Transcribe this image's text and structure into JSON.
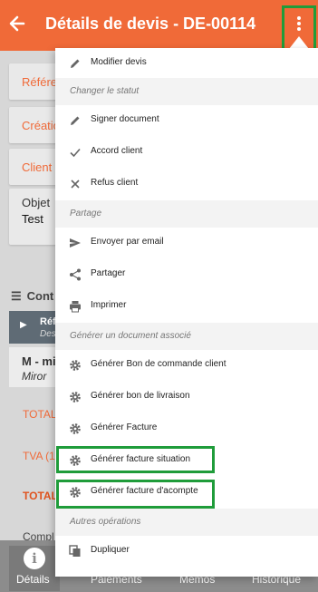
{
  "header": {
    "title": "Détails de devis - DE-00114"
  },
  "page": {
    "fields": [
      "Référe",
      "Création",
      "Client",
      "Objet"
    ],
    "objet_value": "Test",
    "section_title": "Cont",
    "list_header_1": "Réf",
    "list_header_2": "Des",
    "row_title": "M - mi",
    "row_sub": "Miror",
    "total_1": "TOTAL",
    "tva": "TVA (1",
    "total_2": "TOTAL",
    "compl": "Compl"
  },
  "menu": {
    "modifier": "Modifier devis",
    "group_statut": "Changer le statut",
    "signer": "Signer document",
    "accord": "Accord client",
    "refus": "Refus client",
    "group_partage": "Partage",
    "envoyer": "Envoyer par email",
    "partager": "Partager",
    "imprimer": "Imprimer",
    "group_generer": "Générer un document associé",
    "gen_bon_commande": "Générer Bon de commande client",
    "gen_bon_livraison": "Générer bon de livraison",
    "gen_facture": "Générer Facture",
    "gen_facture_situation": "Générer facture situation",
    "gen_facture_acompte": "Générer facture d'acompte",
    "group_autres": "Autres opérations",
    "dupliquer": "Dupliquer"
  },
  "bottom_nav": {
    "details": "Détails",
    "paiements": "Paiements",
    "memos": "Mémos",
    "historique": "Historique"
  },
  "colors": {
    "brand": "#f06a38",
    "highlight": "#1f9c3a"
  }
}
